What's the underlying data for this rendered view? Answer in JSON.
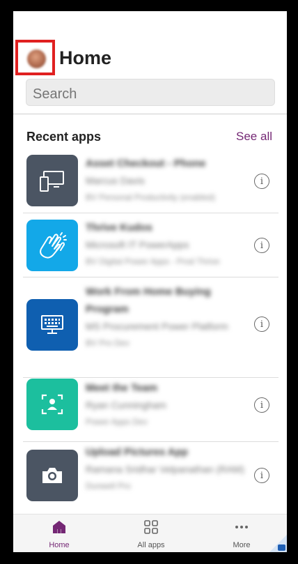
{
  "header": {
    "title": "Home",
    "search_placeholder": "Search"
  },
  "recent": {
    "title": "Recent apps",
    "see_all": "See all"
  },
  "apps": [
    {
      "name": "Asset Checkout - Phone",
      "owner": "Marcus Davis",
      "env": "BV Personal Productivity (enabled)",
      "icon": "monitor-phone-icon",
      "color": "#4b5563"
    },
    {
      "name": "Thrive Kudos",
      "owner": "Microsoft IT PowerApps",
      "env": "BV Digital Power Apps - Prod Thrive",
      "icon": "clapping-hands-icon",
      "color": "#13a8e8"
    },
    {
      "name": "Work From Home Buying Program",
      "owner": "MS Procurement Power Platform",
      "env": "BV Pro Dev",
      "icon": "keyboard-screen-icon",
      "color": "#0f5fb0"
    },
    {
      "name": "Meet the Team",
      "owner": "Ryan Cunningham",
      "env": "Power Apps Dev",
      "icon": "person-focus-icon",
      "color": "#1cbf9e"
    },
    {
      "name": "Upload Pictures App",
      "owner": "Ramana Sridhar Velpanathan (RAM)",
      "env": "Dunwell Pro",
      "icon": "camera-icon",
      "color": "#4b5563"
    }
  ],
  "nav": {
    "home": "Home",
    "all_apps": "All apps",
    "more": "More",
    "accent": "#742774"
  }
}
